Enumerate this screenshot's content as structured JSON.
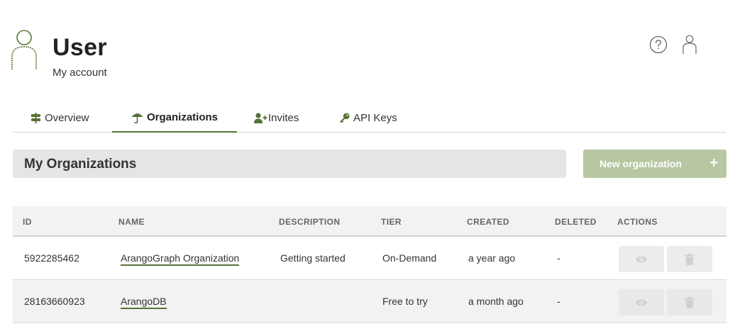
{
  "header": {
    "title": "User",
    "subtitle": "My account",
    "icon": "user-outline-icon"
  },
  "topbar": {
    "help_icon": "help-circle-icon",
    "user_icon": "user-outline-icon"
  },
  "tabs": [
    {
      "label": "Overview",
      "icon": "signpost-icon",
      "active": false
    },
    {
      "label": "Organizations",
      "icon": "umbrella-icon",
      "active": true
    },
    {
      "label": "Invites",
      "icon": "user-plus-icon",
      "active": false
    },
    {
      "label": "API Keys",
      "icon": "key-icon",
      "active": false
    }
  ],
  "section": {
    "title": "My Organizations",
    "new_button_label": "New organization",
    "new_button_plus": "+"
  },
  "table": {
    "columns": [
      "ID",
      "NAME",
      "DESCRIPTION",
      "TIER",
      "CREATED",
      "DELETED",
      "ACTIONS"
    ],
    "rows": [
      {
        "id": "5922285462",
        "name": "ArangoGraph Organization",
        "description": "Getting started",
        "tier": "On-Demand",
        "created": "a year ago",
        "deleted": "-"
      },
      {
        "id": "28163660923",
        "name": "ArangoDB",
        "description": "",
        "tier": "Free to try",
        "created": "a month ago",
        "deleted": "-"
      }
    ],
    "row_actions": [
      "view-eye-icon",
      "delete-trash-icon"
    ]
  },
  "colors": {
    "accent": "#577138",
    "button_disabled": "#b6c7a2",
    "section_bg": "#e5e5e5"
  }
}
